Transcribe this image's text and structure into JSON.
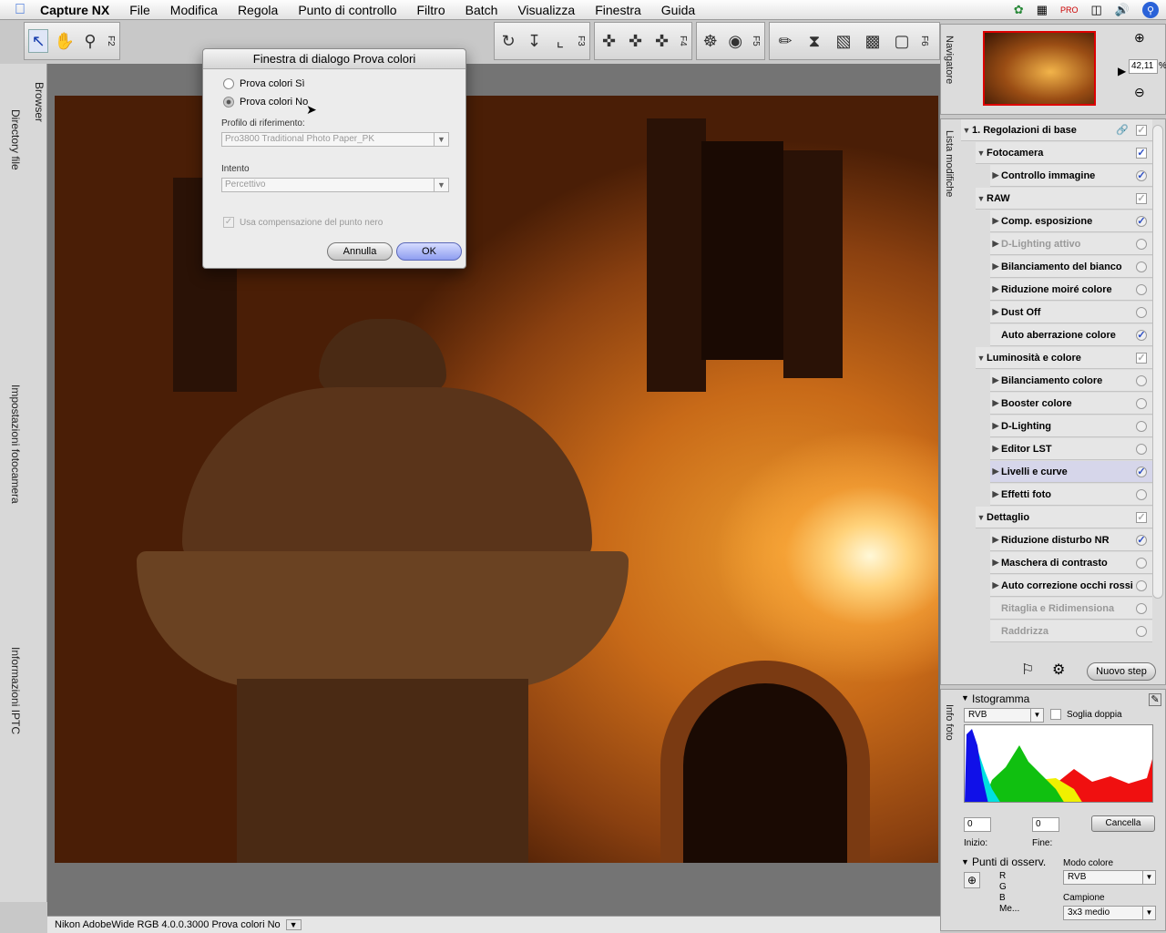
{
  "menubar": {
    "app": "Capture NX",
    "items": [
      "File",
      "Modifica",
      "Regola",
      "Punto di controllo",
      "Filtro",
      "Batch",
      "Visualizza",
      "Finestra",
      "Guida"
    ],
    "tray_flag_label": "PRO"
  },
  "toolbars": {
    "f2": "F2",
    "f3": "F3",
    "f4": "F4",
    "f5": "F5",
    "f6": "F6"
  },
  "left_tabs": {
    "browser": "Browser",
    "directory": "Directory file",
    "camera_settings": "Impostazioni fotocamera",
    "iptc": "Informazioni IPTC"
  },
  "dialog": {
    "title": "Finestra di dialogo Prova colori",
    "option_on": "Prova colori Sì",
    "option_off": "Prova colori No",
    "profile_label": "Profilo di riferimento:",
    "profile_value": "Pro3800 Traditional Photo Paper_PK",
    "intent_label": "Intento",
    "intent_value": "Percettivo",
    "black_point": "Usa compensazione del punto nero",
    "cancel": "Annulla",
    "ok": "OK"
  },
  "navigator": {
    "tab": "Navigatore",
    "zoom": "42,11",
    "zoom_unit": "%"
  },
  "editlist": {
    "tab": "Lista modifiche",
    "step_title": "1. Regolazioni di base",
    "rows": [
      {
        "label": "Fotocamera",
        "level": 0,
        "check": "on",
        "type": "sq"
      },
      {
        "label": "Controllo immagine",
        "level": 1,
        "check": "on",
        "type": "rd"
      },
      {
        "label": "RAW",
        "level": 0,
        "check": "dim",
        "type": "sq"
      },
      {
        "label": "Comp. esposizione",
        "level": 1,
        "check": "on",
        "type": "rd"
      },
      {
        "label": "D-Lighting attivo",
        "level": 1,
        "check": "off",
        "type": "rd",
        "disabled": true
      },
      {
        "label": "Bilanciamento del bianco",
        "level": 1,
        "check": "off",
        "type": "rd"
      },
      {
        "label": "Riduzione moiré colore",
        "level": 1,
        "check": "off",
        "type": "rd"
      },
      {
        "label": "Dust Off",
        "level": 1,
        "check": "off",
        "type": "rd"
      },
      {
        "label": "Auto aberrazione colore",
        "level": 1,
        "check": "on",
        "type": "rd",
        "notri": true
      },
      {
        "label": "Luminosità e colore",
        "level": 0,
        "check": "dim",
        "type": "sq"
      },
      {
        "label": "Bilanciamento colore",
        "level": 1,
        "check": "off",
        "type": "rd"
      },
      {
        "label": "Booster colore",
        "level": 1,
        "check": "off",
        "type": "rd"
      },
      {
        "label": "D-Lighting",
        "level": 1,
        "check": "off",
        "type": "rd"
      },
      {
        "label": "Editor LST",
        "level": 1,
        "check": "off",
        "type": "rd"
      },
      {
        "label": "Livelli e curve",
        "level": 1,
        "check": "on",
        "type": "rd",
        "highlight": true
      },
      {
        "label": "Effetti foto",
        "level": 1,
        "check": "off",
        "type": "rd"
      },
      {
        "label": "Dettaglio",
        "level": 0,
        "check": "dim",
        "type": "sq"
      },
      {
        "label": "Riduzione disturbo NR",
        "level": 1,
        "check": "on",
        "type": "rd"
      },
      {
        "label": "Maschera di contrasto",
        "level": 1,
        "check": "off",
        "type": "rd"
      },
      {
        "label": "Auto correzione occhi rossi",
        "level": 1,
        "check": "off",
        "type": "rd"
      },
      {
        "label": "Ritaglia e Ridimensiona",
        "level": 1,
        "check": "off",
        "type": "rd",
        "disabled": true,
        "notri": true
      },
      {
        "label": "Raddrizza",
        "level": 1,
        "check": "off",
        "type": "rd",
        "disabled": true,
        "notri": true
      }
    ],
    "new_step": "Nuovo step"
  },
  "infofoto": {
    "tab": "Info foto",
    "histogram_title": "Istogramma",
    "channel": "RVB",
    "dual_threshold": "Soglia doppia",
    "start_value": "0",
    "end_value": "0",
    "start_label": "Inizio:",
    "end_label": "Fine:",
    "clear": "Cancella",
    "points_title": "Punti di osserv.",
    "r": "R",
    "g": "G",
    "b": "B",
    "me": "Me...",
    "color_mode_label": "Modo colore",
    "color_mode": "RVB",
    "sample_label": "Campione",
    "sample": "3x3 medio"
  },
  "statusbar": {
    "text": "Nikon AdobeWide RGB 4.0.0.3000  Prova colori No"
  },
  "colors": {
    "accent": "#5a68b8",
    "highlight_row": "#d6d6ea"
  }
}
